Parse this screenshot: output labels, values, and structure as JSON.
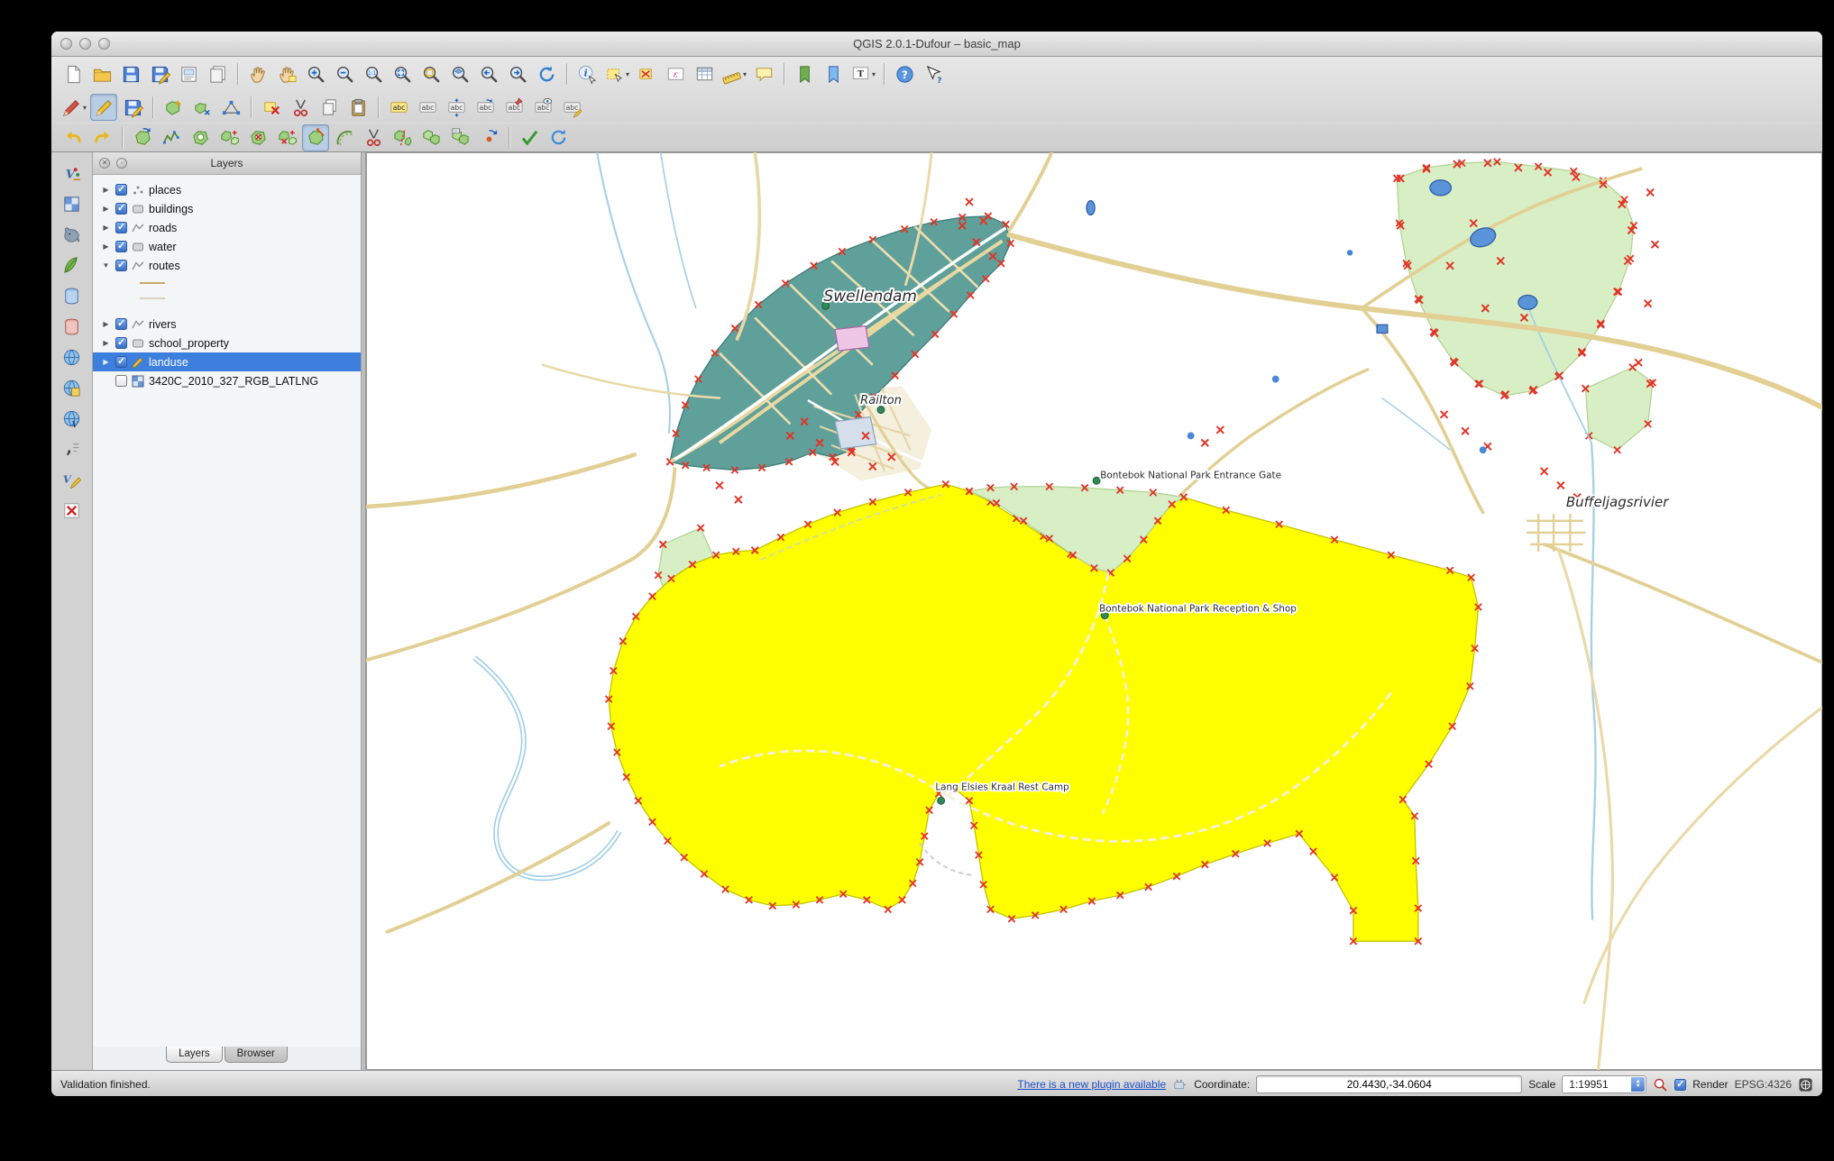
{
  "window": {
    "title": "QGIS 2.0.1-Dufour – basic_map"
  },
  "layers_panel": {
    "title": "Layers",
    "items": [
      {
        "label": "places",
        "checked": true
      },
      {
        "label": "buildings",
        "checked": true
      },
      {
        "label": "roads",
        "checked": true
      },
      {
        "label": "water",
        "checked": true
      },
      {
        "label": "routes",
        "checked": true,
        "expanded": true
      },
      {
        "label": "rivers",
        "checked": true
      },
      {
        "label": "school_property",
        "checked": true
      },
      {
        "label": "landuse",
        "checked": true,
        "selected": true,
        "editing": true
      },
      {
        "label": "3420C_2010_327_RGB_LATLNG",
        "checked": false
      }
    ],
    "tabs": {
      "layers": "Layers",
      "browser": "Browser"
    }
  },
  "map_labels": {
    "swellendam": "Swellendam",
    "railton": "Railton",
    "entrance_gate": "Bontebok National Park Entrance Gate",
    "reception": "Bontebok National Park Reception & Shop",
    "rest_camp": "Lang Elsies Kraal Rest Camp",
    "buffeljagsrivier": "Buffeljagsrivier"
  },
  "status_bar": {
    "message": "Validation finished.",
    "plugin_link": "There is a new plugin available",
    "coordinate_label": "Coordinate:",
    "coordinate_value": "20.4430,-34.0604",
    "scale_label": "Scale",
    "scale_value": "1:19951",
    "render_label": "Render",
    "crs": "EPSG:4326"
  },
  "colors": {
    "landuse_fill": "#ffff00",
    "urban_fill": "#5fa09a",
    "park_fill": "#d8eec4",
    "road": "#e2cf93",
    "river": "#a6d0e6",
    "water_fill": "#5b93d8",
    "vertex_marker": "#e03427",
    "selection_blue": "#3d7fdc",
    "route_symbols": [
      "#c9a96b",
      "#d8d2c0"
    ]
  },
  "toolbars": {
    "row1": [
      "new-project",
      "open-project",
      "save-project",
      "save-project-as",
      "new-print-composer",
      "composer-manager",
      "pan-map",
      "pan-to-selection",
      "zoom-in",
      "zoom-out",
      "zoom-actual",
      "zoom-full",
      "zoom-to-selection",
      "zoom-to-layer",
      "zoom-last",
      "zoom-next",
      "refresh",
      "identify-features",
      "select-features",
      "deselect-all",
      "select-by-expression",
      "open-attribute-table",
      "measure",
      "map-tips",
      "new-bookmark",
      "show-bookmarks",
      "text-annotation",
      "help-contents",
      "whats-this"
    ],
    "row2": [
      "current-edits",
      "toggle-editing",
      "save-layer-edits",
      "add-feature",
      "move-feature",
      "node-tool",
      "delete-selected",
      "cut-features",
      "copy-features",
      "paste-features",
      "labeling",
      "label-properties",
      "move-label",
      "rotate-label",
      "pin-labels",
      "show-hide-labels",
      "change-label"
    ],
    "row3": [
      "undo",
      "redo",
      "rotate-features",
      "simplify-feature",
      "add-ring",
      "add-part",
      "delete-ring",
      "delete-part",
      "reshape-features",
      "offset-curve",
      "split-features",
      "split-parts",
      "merge-features",
      "merge-attributes",
      "rotate-point-symbols",
      "check-geometries",
      "reload-edits"
    ],
    "manage_layers": [
      "add-vector-layer",
      "add-raster-layer",
      "add-postgis-layer",
      "add-spatialite-layer",
      "add-mssql-layer",
      "add-oracle-layer",
      "add-wms-layer",
      "add-wcs-layer",
      "add-wfs-layer",
      "add-delimited-text-layer",
      "new-shapefile-layer",
      "remove-layer"
    ]
  }
}
